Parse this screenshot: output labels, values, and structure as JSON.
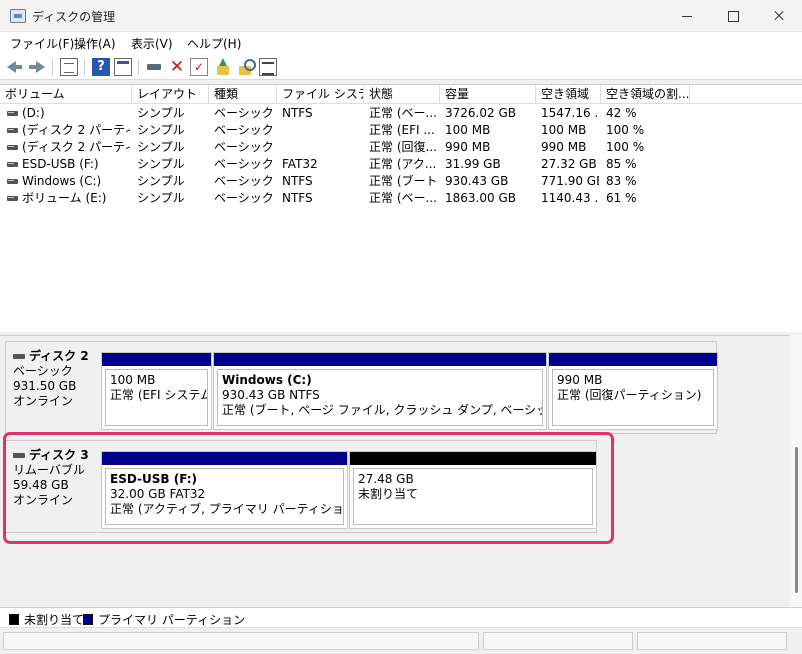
{
  "window": {
    "title": "ディスクの管理"
  },
  "menu": [
    "ファイル(F)",
    "操作(A)",
    "表示(V)",
    "ヘルプ(H)"
  ],
  "toolbar_icons": [
    "back-icon",
    "forward-icon",
    "list-view-icon",
    "help-icon",
    "properties-icon",
    "connect-drive-icon",
    "delete-icon",
    "check-icon",
    "upload-folder-icon",
    "search-folder-icon",
    "settings-icon"
  ],
  "volume_table": {
    "columns": [
      "ボリューム",
      "レイアウト",
      "種類",
      "ファイル システム",
      "状態",
      "容量",
      "空き領域",
      "空き領域の割..."
    ],
    "rows": [
      [
        "(D:)",
        "シンプル",
        "ベーシック",
        "NTFS",
        "正常 (ベー...",
        "3726.02 GB",
        "1547.16 ...",
        "42 %"
      ],
      [
        "(ディスク 2 パーティシ...",
        "シンプル",
        "ベーシック",
        "",
        "正常 (EFI ...",
        "100 MB",
        "100 MB",
        "100 %"
      ],
      [
        "(ディスク 2 パーティシ...",
        "シンプル",
        "ベーシック",
        "",
        "正常 (回復...",
        "990 MB",
        "990 MB",
        "100 %"
      ],
      [
        "ESD-USB (F:)",
        "シンプル",
        "ベーシック",
        "FAT32",
        "正常 (アク...",
        "31.99 GB",
        "27.32 GB",
        "85 %"
      ],
      [
        "Windows (C:)",
        "シンプル",
        "ベーシック",
        "NTFS",
        "正常 (ブート...",
        "930.43 GB",
        "771.90 GB",
        "83 %"
      ],
      [
        "ボリューム (E:)",
        "シンプル",
        "ベーシック",
        "NTFS",
        "正常 (ベー...",
        "1863.00 GB",
        "1140.43 ...",
        "61 %"
      ]
    ]
  },
  "disks": [
    {
      "name": "ディスク 2",
      "type": "ベーシック",
      "size": "931.50 GB",
      "status": "オンライン",
      "partitions": [
        {
          "title": "",
          "size": "100 MB",
          "status": "正常 (EFI システム パ"
        },
        {
          "title": "Windows  (C:)",
          "size": "930.43 GB NTFS",
          "status": "正常 (ブート, ページ ファイル, クラッシュ ダンプ, ベーシック データ パーティ"
        },
        {
          "title": "",
          "size": "990 MB",
          "status": "正常 (回復パーティション)"
        }
      ]
    },
    {
      "name": "ディスク 3",
      "type": "リムーバブル",
      "size": "59.48 GB",
      "status": "オンライン",
      "partitions": [
        {
          "title": "ESD-USB  (F:)",
          "size": "32.00 GB FAT32",
          "status": "正常 (アクティブ, プライマリ パーティション)"
        },
        {
          "title": "",
          "size": "27.48 GB",
          "status": "未割り当て"
        }
      ]
    }
  ],
  "legend": [
    "未割り当て",
    "プライマリ パーティション"
  ],
  "colors": {
    "primary_partition": "#00008b",
    "unallocated": "#000000",
    "highlight": "#e0326f"
  }
}
